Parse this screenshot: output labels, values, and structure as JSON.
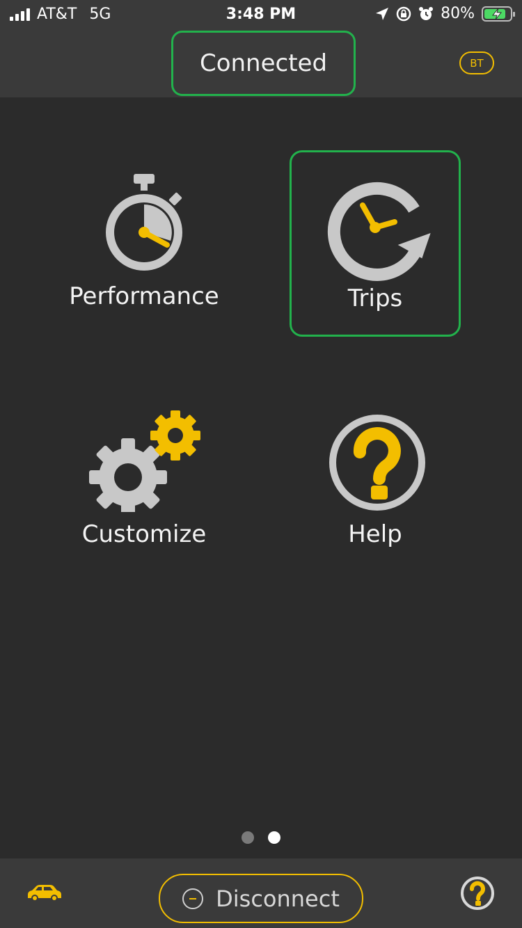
{
  "status_bar": {
    "carrier": "AT&T",
    "network": "5G",
    "time": "3:48 PM",
    "battery": "80%",
    "icons": [
      "signal-icon",
      "location-arrow-icon",
      "rotation-lock-icon",
      "alarm-icon",
      "battery-charging-icon"
    ]
  },
  "header": {
    "status_label": "Connected",
    "bt_label": "BT"
  },
  "tiles": [
    {
      "label": "Performance",
      "icon": "stopwatch-icon"
    },
    {
      "label": "Trips",
      "icon": "clock-refresh-icon",
      "selected": true
    },
    {
      "label": "Customize",
      "icon": "gears-icon"
    },
    {
      "label": "Help",
      "icon": "question-circle-icon"
    }
  ],
  "pager": {
    "current_page": 2,
    "total_pages": 2
  },
  "bottom_bar": {
    "disconnect_label": "Disconnect",
    "left_icon": "car-icon",
    "right_icon": "help-icon"
  },
  "colors": {
    "background": "#2b2b2b",
    "bar": "#3a3a3a",
    "accent_yellow": "#f3be00",
    "selection_green": "#22b24c",
    "icon_gray": "#c8c8c8"
  }
}
